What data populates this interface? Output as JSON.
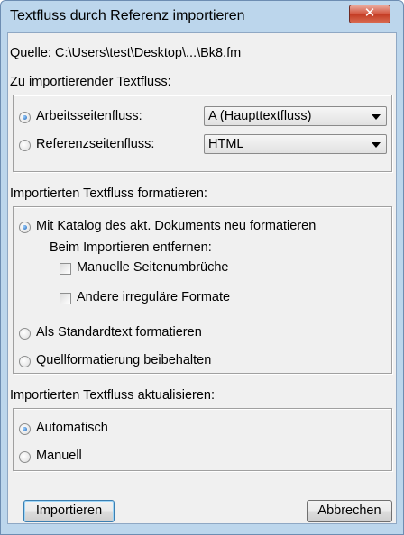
{
  "window": {
    "title": "Textfluss durch Referenz importieren",
    "close_glyph": "✕"
  },
  "source": {
    "label": "Quelle: C:\\Users\\test\\Desktop\\...\\Bk8.fm"
  },
  "import_flow": {
    "label": "Zu importierender Textfluss:",
    "options": [
      {
        "label": "Arbeitsseitenfluss:",
        "selected": true,
        "dropdown": "A (Haupttextfluss)"
      },
      {
        "label": "Referenzseitenfluss:",
        "selected": false,
        "dropdown": "HTML"
      }
    ]
  },
  "format": {
    "label": "Importierten Textfluss formatieren:",
    "option_catalog": "Mit Katalog des akt. Dokuments neu formatieren",
    "remove_label": "Beim Importieren entfernen:",
    "check_page_breaks": "Manuelle Seitenumbrüche",
    "check_other_formats": "Andere irreguläre Formate",
    "option_standard": "Als Standardtext formatieren",
    "option_keep_source": "Quellformatierung beibehalten",
    "selected": "catalog"
  },
  "update": {
    "label": "Importierten Textfluss aktualisieren:",
    "option_auto": "Automatisch",
    "option_manual": "Manuell",
    "selected": "auto"
  },
  "buttons": {
    "import": "Importieren",
    "cancel": "Abbrechen"
  },
  "icons": [
    "close-icon",
    "dropdown-arrow-icon"
  ]
}
